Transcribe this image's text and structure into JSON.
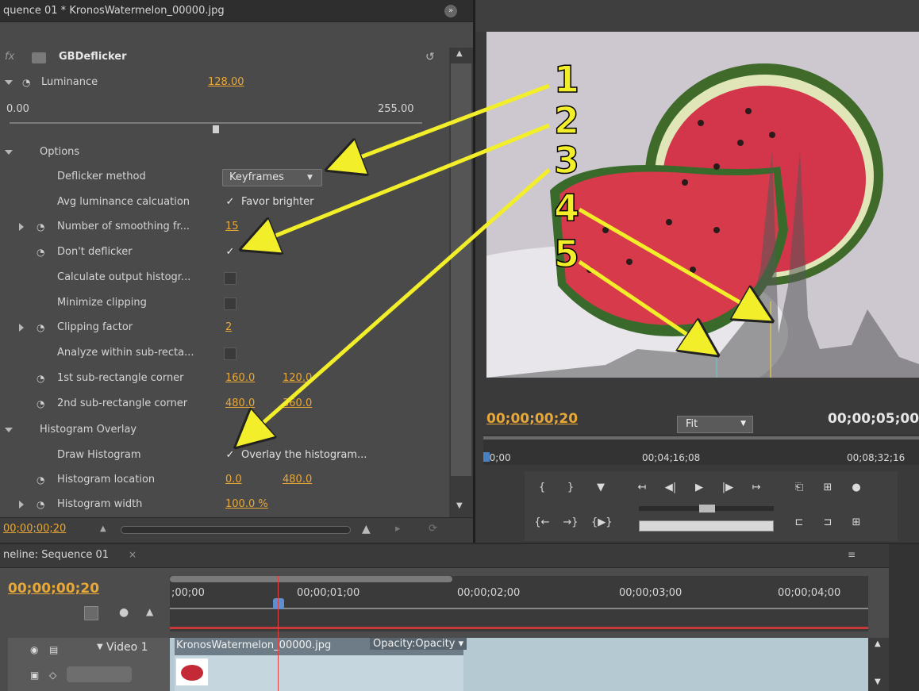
{
  "effect_controls": {
    "tab_title": "quence 01 * KronosWatermelon_00000.jpg",
    "effect_name": "GBDeflicker",
    "fx_label": "fx",
    "luminance_label": "Luminance",
    "luminance_value": "128.00",
    "slider_min": "0.00",
    "slider_max": "255.00",
    "luminance_fraction": 0.5,
    "options_label": "Options",
    "deflicker_method_label": "Deflicker method",
    "deflicker_method_value": "Keyframes",
    "avg_luminance_label": "Avg luminance calcuation",
    "favor_brighter_label": "Favor brighter",
    "smoothing_label": "Number of smoothing fr...",
    "smoothing_value": "15",
    "dont_deflicker_label": "Don't deflicker",
    "calc_output_label": "Calculate output histogr...",
    "minimize_clipping_label": "Minimize clipping",
    "clipping_factor_label": "Clipping factor",
    "clipping_factor_value": "2",
    "analyze_sub_label": "Analyze within sub-recta...",
    "sub1_label": "1st sub-rectangle corner",
    "sub1_x": "160.0",
    "sub1_y": "120.0",
    "sub2_label": "2nd sub-rectangle corner",
    "sub2_x": "480.0",
    "sub2_y": "360.0",
    "histogram_overlay_label": "Histogram Overlay",
    "draw_histogram_label": "Draw Histogram",
    "overlay_label": "Overlay the histogram...",
    "histogram_location_label": "Histogram location",
    "histogram_location_x": "0.0",
    "histogram_location_y": "480.0",
    "histogram_width_label": "Histogram width",
    "histogram_width_value": "100.0 %",
    "bottom_timecode": "00;00;00;20"
  },
  "program_monitor": {
    "current_time": "00;00;00;20",
    "duration": "00;00;05;00",
    "fit_label": "Fit",
    "ruler_labels": [
      "00;00",
      "00;04;16;08",
      "00;08;32;16"
    ]
  },
  "timeline": {
    "tab_title": "neline: Sequence 01",
    "current_time": "00;00;00;20",
    "ruler_labels": [
      ";00;00",
      "00;00;01;00",
      "00;00;02;00",
      "00;00;03;00",
      "00;00;04;00"
    ],
    "track_name": "Video 1",
    "clip_name": "KronosWatermelon_00000.jpg",
    "clip_property": "Opacity:Opacity"
  },
  "annotations": [
    "1",
    "2",
    "3",
    "4",
    "5"
  ],
  "colors": {
    "accent_timecode": "#e8a838",
    "arrow_yellow": "#f2ee2a",
    "panel_bg": "#4a4a4a"
  }
}
